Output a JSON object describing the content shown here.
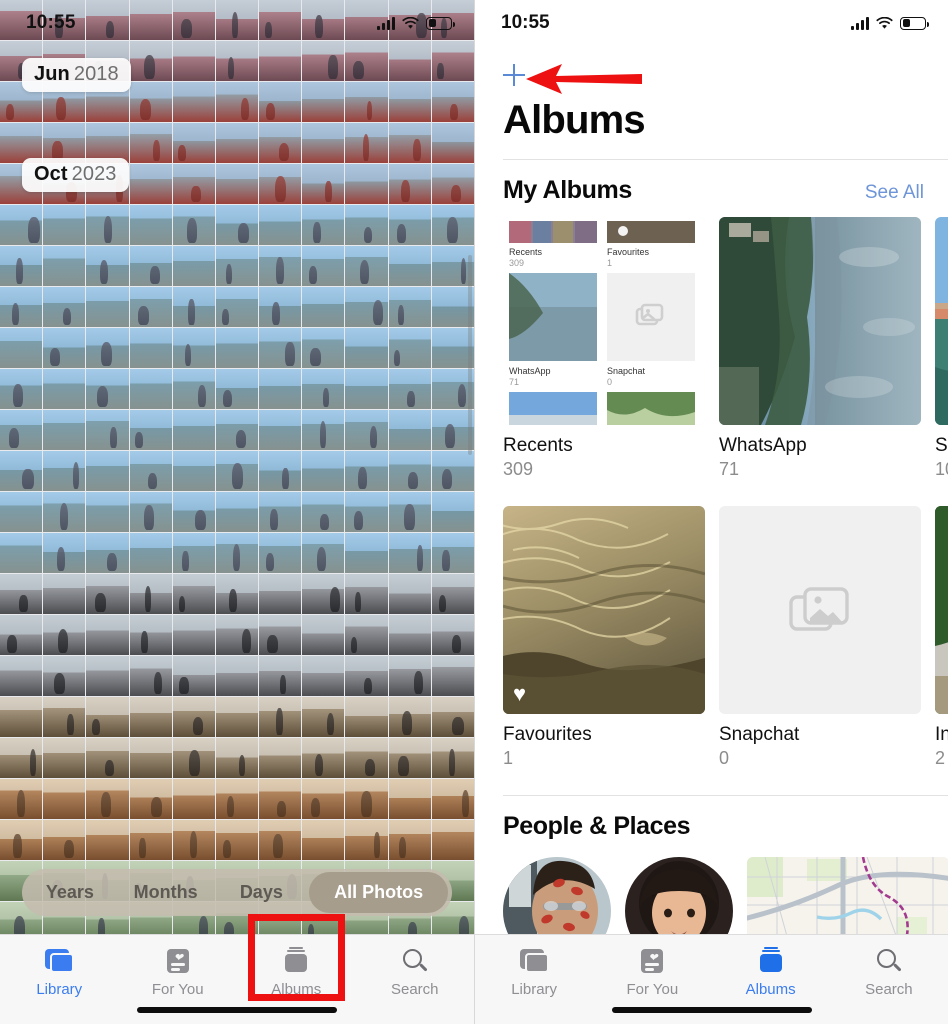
{
  "left_panel": {
    "status_bar": {
      "time": "10:55",
      "cellular_icon": "cellular-bars-icon",
      "wifi_icon": "wifi-icon",
      "battery_icon": "battery-icon"
    },
    "date_badges": [
      {
        "month": "Jun",
        "year": "2018"
      },
      {
        "month": "Oct",
        "year": "2023"
      }
    ],
    "segmented_control": {
      "options": [
        "Years",
        "Months",
        "Days",
        "All Photos"
      ],
      "selected": "All Photos"
    },
    "tabs": [
      {
        "label": "Library",
        "icon": "library-icon",
        "active": true
      },
      {
        "label": "For You",
        "icon": "for-you-icon",
        "active": false
      },
      {
        "label": "Albums",
        "icon": "albums-icon",
        "active": false
      },
      {
        "label": "Search",
        "icon": "search-icon",
        "active": false
      }
    ]
  },
  "right_panel": {
    "status_bar": {
      "time": "10:55",
      "cellular_icon": "cellular-bars-icon",
      "wifi_icon": "wifi-icon",
      "battery_icon": "battery-icon"
    },
    "add_button_icon": "plus-icon",
    "title": "Albums",
    "sections": [
      {
        "heading": "My Albums",
        "action_label": "See All",
        "rows": [
          [
            {
              "name": "Recents",
              "count": "309",
              "thumb": "nested-albums-screenshot"
            },
            {
              "name": "WhatsApp",
              "count": "71",
              "thumb": "landscape-lake-photo"
            },
            {
              "name": "S",
              "count": "10",
              "thumb": "beach-photo",
              "partial": true
            }
          ],
          [
            {
              "name": "Favourites",
              "count": "1",
              "thumb": "sand-water-photo",
              "badge": "heart-icon"
            },
            {
              "name": "Snapchat",
              "count": "0",
              "thumb": "empty-album-placeholder"
            },
            {
              "name": "In",
              "count": "2",
              "thumb": "road-trees-photo",
              "partial": true
            }
          ]
        ]
      },
      {
        "heading": "People & Places",
        "people": [
          {
            "name_icon": "person-face-avatar-1"
          },
          {
            "name_icon": "person-face-avatar-2"
          }
        ],
        "places": [
          {
            "name_icon": "map-thumbnail"
          },
          {
            "name_icon": "map-thumbnail-partial"
          }
        ]
      }
    ],
    "tabs": [
      {
        "label": "Library",
        "icon": "library-icon",
        "active": false
      },
      {
        "label": "For You",
        "icon": "for-you-icon",
        "active": false
      },
      {
        "label": "Albums",
        "icon": "albums-icon",
        "active": true
      },
      {
        "label": "Search",
        "icon": "search-icon",
        "active": false
      }
    ]
  },
  "annotations": {
    "arrow": {
      "icon": "red-arrow-pointing-left",
      "color": "#ee1111"
    },
    "highlight_box": {
      "icon": "red-rectangle-highlight",
      "color": "#ee1111",
      "target": "albums-tab"
    }
  }
}
